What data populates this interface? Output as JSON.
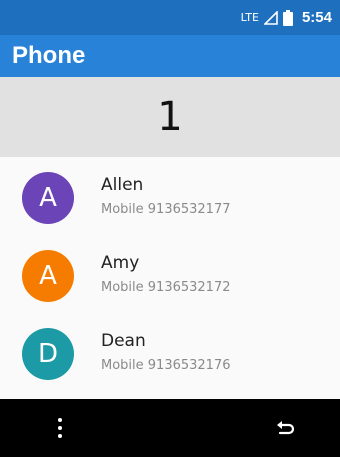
{
  "status_bar": {
    "network": "LTE",
    "time": "5:54",
    "icons": [
      "signal-icon",
      "battery-icon"
    ]
  },
  "app_bar": {
    "title": "Phone"
  },
  "dial": {
    "digits": "1"
  },
  "contacts": [
    {
      "initial": "A",
      "name": "Allen",
      "number": "Mobile 9136532177",
      "color": "#6b44b8"
    },
    {
      "initial": "A",
      "name": "Amy",
      "number": "Mobile 9136532172",
      "color": "#f57c00"
    },
    {
      "initial": "D",
      "name": "Dean",
      "number": "Mobile 9136532176",
      "color": "#1c9aa6"
    }
  ],
  "nav_bar": {
    "icons": [
      "more-vert-icon",
      "back-icon"
    ]
  },
  "colors": {
    "status_bar": "#1e6fbd",
    "app_bar": "#2782d8",
    "dial_background": "#e1e1e1"
  }
}
